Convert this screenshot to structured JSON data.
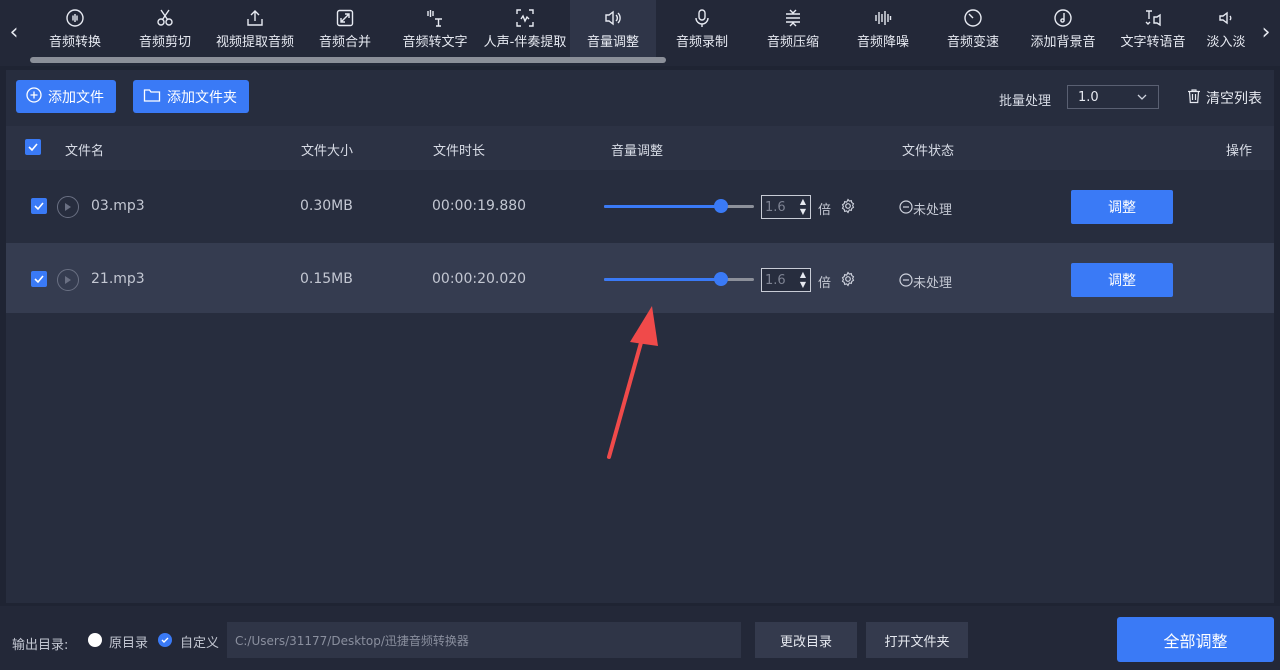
{
  "toolbar": {
    "tools": [
      {
        "label": "音频转换",
        "icon": "audio-convert-icon",
        "width": 90
      },
      {
        "label": "音频剪切",
        "icon": "scissors-icon",
        "width": 90
      },
      {
        "label": "视频提取音频",
        "icon": "upload-icon",
        "width": 90
      },
      {
        "label": "音频合并",
        "icon": "merge-icon",
        "width": 90
      },
      {
        "label": "音频转文字",
        "icon": "speech-to-text-icon",
        "width": 90
      },
      {
        "label": "人声-伴奏提取",
        "icon": "voice-separate-icon",
        "width": 90
      },
      {
        "label": "音量调整",
        "icon": "volume-icon",
        "width": 86,
        "active": true
      },
      {
        "label": "音频录制",
        "icon": "microphone-icon",
        "width": 92
      },
      {
        "label": "音频压缩",
        "icon": "compress-icon",
        "width": 90
      },
      {
        "label": "音频降噪",
        "icon": "noise-reduce-icon",
        "width": 90
      },
      {
        "label": "音频变速",
        "icon": "speed-icon",
        "width": 90
      },
      {
        "label": "添加背景音",
        "icon": "music-note-icon",
        "width": 90
      },
      {
        "label": "文字转语音",
        "icon": "text-to-speech-icon",
        "width": 90
      },
      {
        "label": "淡入淡",
        "icon": "fade-icon",
        "width": 56
      }
    ],
    "scroll_fraction": 0.52
  },
  "actions": {
    "add_file": "添加文件",
    "add_folder": "添加文件夹",
    "batch_label": "批量处理",
    "batch_value": "1.0",
    "clear_list": "清空列表"
  },
  "table": {
    "headers": {
      "name": "文件名",
      "size": "文件大小",
      "duration": "文件时长",
      "volume": "音量调整",
      "status": "文件状态",
      "action": "操作"
    },
    "rows": [
      {
        "name": "03.mp3",
        "size": "0.30MB",
        "duration": "00:00:19.880",
        "volume": "1.6",
        "unit": "倍",
        "volume_fraction": 0.78,
        "status": "未处理",
        "button": "调整",
        "checked": true
      },
      {
        "name": "21.mp3",
        "size": "0.15MB",
        "duration": "00:00:20.020",
        "volume": "1.6",
        "unit": "倍",
        "volume_fraction": 0.78,
        "status": "未处理",
        "button": "调整",
        "checked": true
      }
    ]
  },
  "bottom": {
    "output_label": "输出目录:",
    "option_original": "原目录",
    "option_custom": "自定义",
    "selected": "custom",
    "path": "C:/Users/31177/Desktop/迅捷音频转换器",
    "change_dir": "更改目录",
    "open_folder": "打开文件夹",
    "adjust_all": "全部调整"
  },
  "colors": {
    "accent": "#3a7af6",
    "annotation": "#f04a4a",
    "background": "#1f2433"
  }
}
